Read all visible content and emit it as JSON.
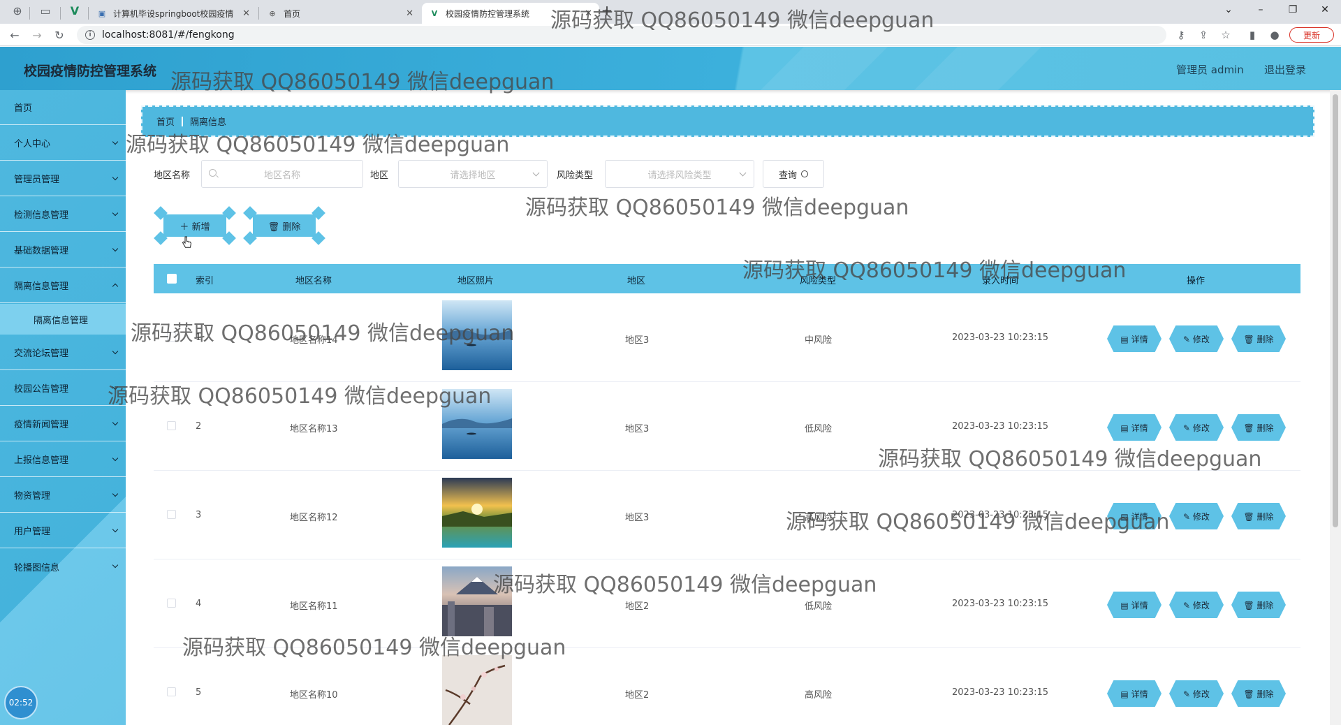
{
  "browser": {
    "tabs": [
      {
        "title": "计算机毕设springboot校园疫情",
        "active": false
      },
      {
        "title": "首页",
        "active": false
      },
      {
        "title": "校园疫情防控管理系统",
        "active": true
      }
    ],
    "url": "localhost:8081/#/fengkong",
    "update_label": "更新"
  },
  "header": {
    "title": "校园疫情防控管理系统",
    "admin": "管理员 admin",
    "logout": "退出登录"
  },
  "sidebar": {
    "items": [
      {
        "label": "首页",
        "has_children": false
      },
      {
        "label": "个人中心",
        "has_children": true
      },
      {
        "label": "管理员管理",
        "has_children": true
      },
      {
        "label": "检测信息管理",
        "has_children": true
      },
      {
        "label": "基础数据管理",
        "has_children": true
      },
      {
        "label": "隔离信息管理",
        "has_children": true,
        "expanded": true
      },
      {
        "label": "交流论坛管理",
        "has_children": true
      },
      {
        "label": "校园公告管理",
        "has_children": true
      },
      {
        "label": "疫情新闻管理",
        "has_children": true
      },
      {
        "label": "上报信息管理",
        "has_children": true
      },
      {
        "label": "物资管理",
        "has_children": true
      },
      {
        "label": "用户管理",
        "has_children": true
      },
      {
        "label": "轮播图信息",
        "has_children": true
      }
    ],
    "submenu": {
      "label": "隔离信息管理"
    },
    "clock": "02:52"
  },
  "breadcrumb": {
    "home": "首页",
    "current": "隔离信息"
  },
  "search": {
    "name_label": "地区名称",
    "name_placeholder": "地区名称",
    "region_label": "地区",
    "region_placeholder": "请选择地区",
    "risk_label": "风险类型",
    "risk_placeholder": "请选择风险类型",
    "query_label": "查询"
  },
  "actions": {
    "add": "新增",
    "delete": "删除"
  },
  "table": {
    "headers": [
      "索引",
      "地区名称",
      "地区照片",
      "地区",
      "风险类型",
      "录入时间",
      "操作"
    ],
    "rows": [
      {
        "index": "1",
        "name": "地区名称14",
        "region": "地区3",
        "risk": "中风险",
        "time": "2023-03-23 10:23:15",
        "photo": "lake"
      },
      {
        "index": "2",
        "name": "地区名称13",
        "region": "地区3",
        "risk": "低风险",
        "time": "2023-03-23 10:23:15",
        "photo": "lake"
      },
      {
        "index": "3",
        "name": "地区名称12",
        "region": "地区3",
        "risk": "高风险",
        "time": "2023-03-23 10:23:15",
        "photo": "sunset"
      },
      {
        "index": "4",
        "name": "地区名称11",
        "region": "地区2",
        "risk": "低风险",
        "time": "2023-03-23 10:23:15",
        "photo": "city"
      },
      {
        "index": "5",
        "name": "地区名称10",
        "region": "地区2",
        "risk": "高风险",
        "time": "2023-03-23 10:23:15",
        "photo": "blossom"
      }
    ],
    "ops": {
      "detail": "详情",
      "edit": "修改",
      "delete": "删除"
    }
  },
  "watermark": "源码获取 QQ86050149 微信deepguan",
  "colors": {
    "primary": "#4fb8df",
    "button": "#5ec2e6",
    "text_dark": "#0d2333"
  }
}
